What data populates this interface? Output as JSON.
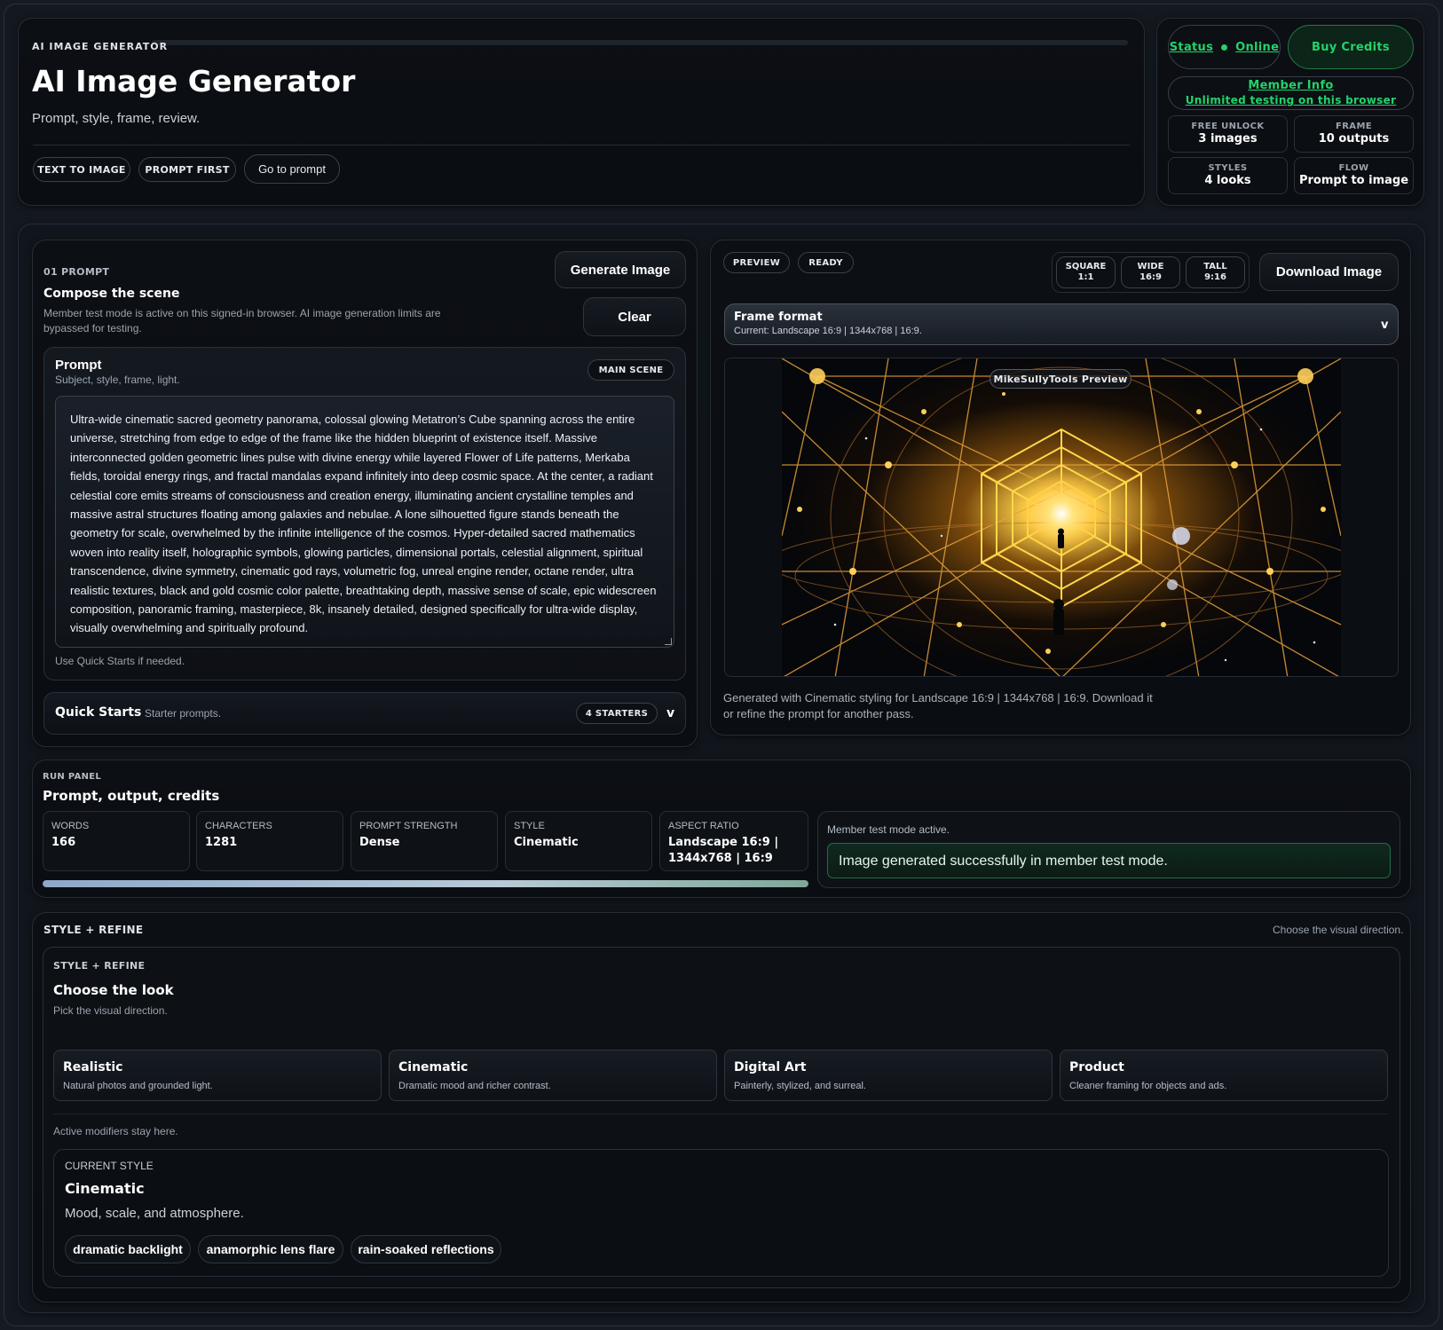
{
  "header": {
    "eyebrow": "AI IMAGE GENERATOR",
    "title": "AI Image Generator",
    "subtitle": "Prompt, style, frame, review.",
    "tags": [
      "TEXT TO IMAGE",
      "PROMPT FIRST"
    ],
    "goto_label": "Go to prompt"
  },
  "status_panel": {
    "status_label": "Status",
    "status_value": "Online",
    "buy_label": "Buy Credits",
    "member_title": "Member Info",
    "member_sub": "Unlimited testing on this browser",
    "stats": [
      {
        "label": "FREE UNLOCK",
        "value": "3 images"
      },
      {
        "label": "FRAME",
        "value": "10 outputs"
      },
      {
        "label": "STYLES",
        "value": "4 looks"
      },
      {
        "label": "FLOW",
        "value": "Prompt to image"
      }
    ]
  },
  "prompt_panel": {
    "eyebrow": "01 PROMPT",
    "title": "Compose the scene",
    "desc_line1": "Member test mode is active on this signed-in browser. AI image generation limits are",
    "desc_line2": "bypassed for testing.",
    "generate_label": "Generate Image",
    "clear_label": "Clear",
    "box_title": "Prompt",
    "box_sub": "Subject, style, frame, light.",
    "badge": "MAIN SCENE",
    "prompt_text": "Ultra-wide cinematic sacred geometry panorama, colossal glowing Metatron’s Cube spanning across the entire universe, stretching from edge to edge of the frame like the hidden blueprint of existence itself. Massive interconnected golden geometric lines pulse with divine energy while layered Flower of Life patterns, Merkaba fields, toroidal energy rings, and fractal mandalas expand infinitely into deep cosmic space. At the center, a radiant celestial core emits streams of consciousness and creation energy, illuminating ancient crystalline temples and massive astral structures floating among galaxies and nebulae. A lone silhouetted figure stands beneath the geometry for scale, overwhelmed by the infinite intelligence of the cosmos. Hyper-detailed sacred mathematics woven into reality itself, holographic symbols, glowing particles, dimensional portals, celestial alignment, spiritual transcendence, divine symmetry, cinematic god rays, volumetric fog, unreal engine render, octane render, ultra realistic textures, black and gold cosmic color palette, breathtaking depth, massive sense of scale, epic widescreen composition, panoramic framing, masterpiece, 8k, insanely detailed, designed specifically for ultra-wide display, visually overwhelming and spiritually profound.",
    "hint": "Use Quick Starts if needed.",
    "quick_title": "Quick Starts",
    "quick_sub": "Starter prompts.",
    "quick_badge": "4 STARTERS",
    "quick_chevron": "v"
  },
  "preview_panel": {
    "tags": [
      "PREVIEW",
      "READY"
    ],
    "aspects": [
      {
        "name": "SQUARE",
        "ratio": "1:1"
      },
      {
        "name": "WIDE",
        "ratio": "16:9"
      },
      {
        "name": "TALL",
        "ratio": "9:16"
      }
    ],
    "download_label": "Download Image",
    "frame_title": "Frame format",
    "frame_current": "Current: Landscape 16:9 | 1344x768 | 16:9.",
    "frame_chevron": "v",
    "watermark": "MikeSullyTools Preview",
    "caption_line1": "Generated with Cinematic styling for Landscape 16:9 | 1344x768 | 16:9. Download it",
    "caption_line2": "or refine the prompt for another pass."
  },
  "run_panel": {
    "eyebrow": "RUN PANEL",
    "title": "Prompt, output, credits",
    "metrics": [
      {
        "label": "WORDS",
        "value": "166"
      },
      {
        "label": "CHARACTERS",
        "value": "1281"
      },
      {
        "label": "PROMPT STRENGTH",
        "value": "Dense"
      },
      {
        "label": "STYLE",
        "value": "Cinematic"
      },
      {
        "label": "ASPECT RATIO",
        "value": "Landscape 16:9 | 1344x768 | 16:9"
      }
    ],
    "progress": 1.0,
    "member_note": "Member test mode active.",
    "success": "Image generated successfully in member test mode."
  },
  "style_panel": {
    "eyebrow": "STYLE + REFINE",
    "right_note": "Choose the visual direction.",
    "inner_eyebrow": "STYLE + REFINE",
    "title": "Choose the look",
    "sub": "Pick the visual direction.",
    "styles": [
      {
        "name": "Realistic",
        "desc": "Natural photos and grounded light."
      },
      {
        "name": "Cinematic",
        "desc": "Dramatic mood and richer contrast."
      },
      {
        "name": "Digital Art",
        "desc": "Painterly, stylized, and surreal."
      },
      {
        "name": "Product",
        "desc": "Cleaner framing for objects and ads."
      }
    ],
    "modifiers_note": "Active modifiers stay here.",
    "current_label": "CURRENT STYLE",
    "current_name": "Cinematic",
    "current_desc": "Mood, scale, and atmosphere.",
    "chips": [
      "dramatic backlight",
      "anamorphic lens flare",
      "rain-soaked reflections"
    ]
  },
  "colors": {
    "accent_green": "#22d36a",
    "background": "#161b22"
  }
}
